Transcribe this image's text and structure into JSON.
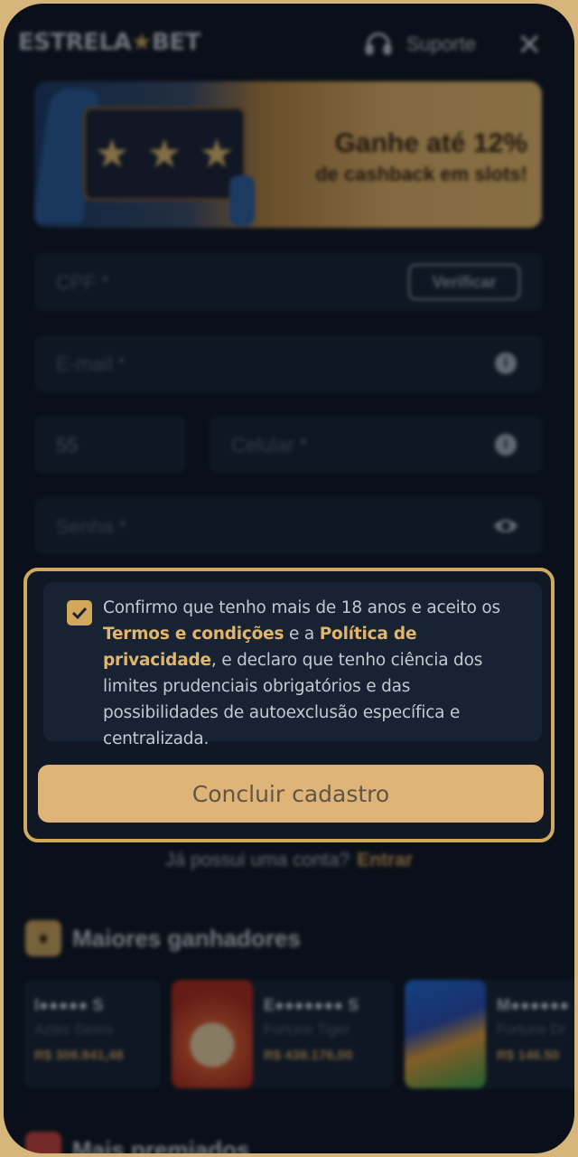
{
  "header": {
    "logo_left": "ESTRELA",
    "logo_star": "★",
    "logo_right": "BET",
    "support_label": "Suporte",
    "close_symbol": "✕"
  },
  "banner": {
    "title": "Ganhe até 12%",
    "subtitle": "de cashback em slots!"
  },
  "form": {
    "cpf_placeholder": "CPF *",
    "verify_label": "Verificar",
    "email_placeholder": "E-mail *",
    "country_code": "55",
    "phone_placeholder": "Celular *",
    "password_placeholder": "Senha *"
  },
  "terms": {
    "checked": true,
    "text_1": "Confirmo que tenho mais de 18 anos e aceito os ",
    "terms_link": "Termos e condições",
    "text_2": " e a ",
    "privacy_link": "Política de privacidade",
    "text_3": ", e declaro que tenho ciência dos limites prudenciais obrigatórios e das possibilidades de autoexclusão específica e centralizada."
  },
  "submit_label": "Concluir cadastro",
  "login_prompt": {
    "text": "Já possui uma conta?",
    "link": "Entrar"
  },
  "winners": {
    "title": "Maiores ganhadores",
    "items": [
      {
        "name": "I●●●●● S",
        "game": "Aztec Gems",
        "amount": "R$ 308.841,48"
      },
      {
        "name": "E●●●●●●● S",
        "game": "Fortune Tiger",
        "amount": "R$ 438.176,00"
      },
      {
        "name": "M●●●●●●",
        "game": "Fortune Dr",
        "amount": "R$ 146.50"
      }
    ]
  },
  "next_section_title": "Mais premiados",
  "colors": {
    "accent": "#d4a85a",
    "frame": "#d7b67c",
    "background": "#0e1520"
  }
}
